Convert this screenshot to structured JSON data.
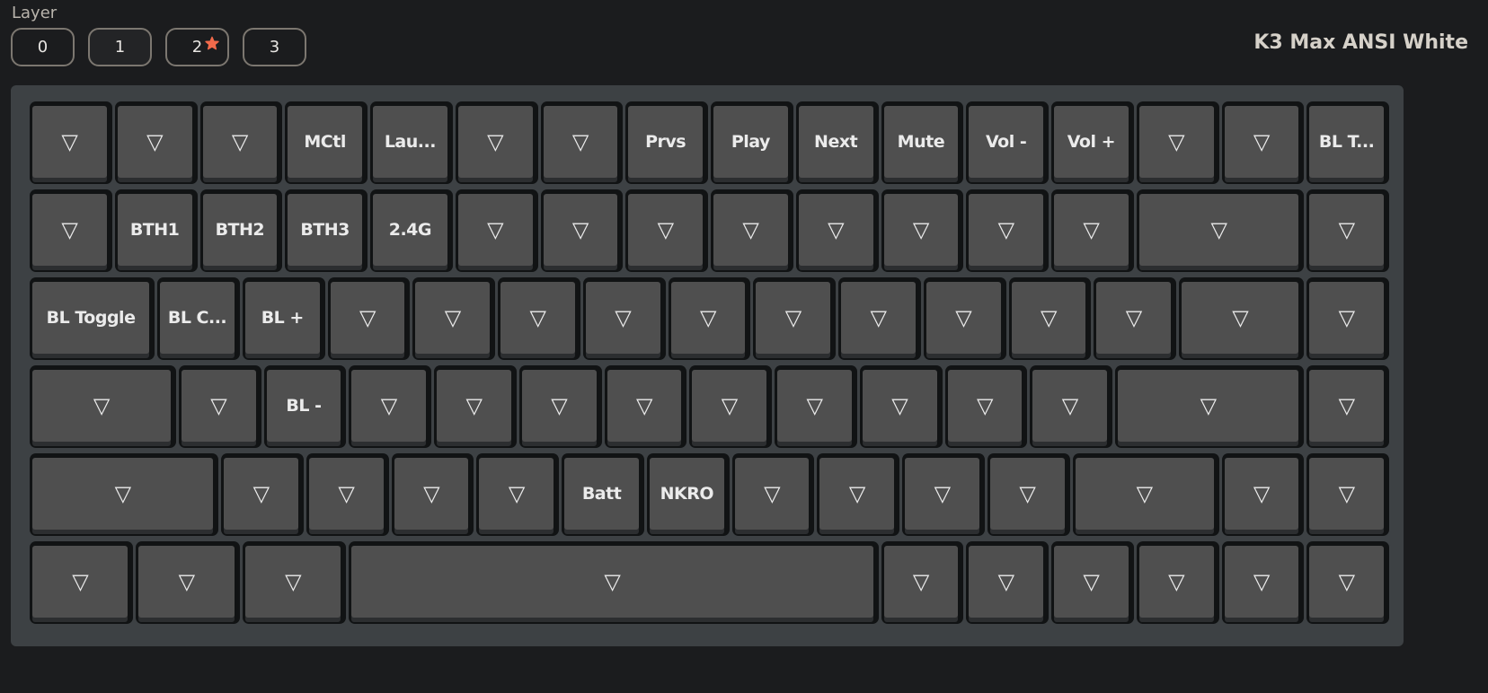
{
  "layer": {
    "label": "Layer",
    "tabs": [
      {
        "label": "0",
        "active": false,
        "starred": false
      },
      {
        "label": "1",
        "active": true,
        "starred": false
      },
      {
        "label": "2",
        "active": false,
        "starred": true
      },
      {
        "label": "3",
        "active": false,
        "starred": false
      }
    ],
    "star_color": "#f26a4b"
  },
  "keyboard_name": "K3 Max ANSI White",
  "transparent_glyph": "▽",
  "rows": [
    [
      {
        "w": 1,
        "label": "▽"
      },
      {
        "w": 1,
        "label": "▽"
      },
      {
        "w": 1,
        "label": "▽"
      },
      {
        "w": 1,
        "label": "MCtl"
      },
      {
        "w": 1,
        "label": "Lau..."
      },
      {
        "w": 1,
        "label": "▽"
      },
      {
        "w": 1,
        "label": "▽"
      },
      {
        "w": 1,
        "label": "Prvs"
      },
      {
        "w": 1,
        "label": "Play"
      },
      {
        "w": 1,
        "label": "Next"
      },
      {
        "w": 1,
        "label": "Mute"
      },
      {
        "w": 1,
        "label": "Vol -"
      },
      {
        "w": 1,
        "label": "Vol +"
      },
      {
        "w": 1,
        "label": "▽"
      },
      {
        "w": 1,
        "label": "▽"
      },
      {
        "w": 1,
        "label": "BL T..."
      }
    ],
    [
      {
        "w": 1,
        "label": "▽"
      },
      {
        "w": 1,
        "label": "BTH1"
      },
      {
        "w": 1,
        "label": "BTH2"
      },
      {
        "w": 1,
        "label": "BTH3"
      },
      {
        "w": 1,
        "label": "2.4G"
      },
      {
        "w": 1,
        "label": "▽"
      },
      {
        "w": 1,
        "label": "▽"
      },
      {
        "w": 1,
        "label": "▽"
      },
      {
        "w": 1,
        "label": "▽"
      },
      {
        "w": 1,
        "label": "▽"
      },
      {
        "w": 1,
        "label": "▽"
      },
      {
        "w": 1,
        "label": "▽"
      },
      {
        "w": 1,
        "label": "▽"
      },
      {
        "w": 2,
        "label": "▽"
      },
      {
        "w": 1,
        "label": "▽"
      }
    ],
    [
      {
        "w": 1.5,
        "label": "BL Toggle"
      },
      {
        "w": 1,
        "label": "BL C..."
      },
      {
        "w": 1,
        "label": "BL +"
      },
      {
        "w": 1,
        "label": "▽"
      },
      {
        "w": 1,
        "label": "▽"
      },
      {
        "w": 1,
        "label": "▽"
      },
      {
        "w": 1,
        "label": "▽"
      },
      {
        "w": 1,
        "label": "▽"
      },
      {
        "w": 1,
        "label": "▽"
      },
      {
        "w": 1,
        "label": "▽"
      },
      {
        "w": 1,
        "label": "▽"
      },
      {
        "w": 1,
        "label": "▽"
      },
      {
        "w": 1,
        "label": "▽"
      },
      {
        "w": 1.5,
        "label": "▽"
      },
      {
        "w": 1,
        "label": "▽"
      }
    ],
    [
      {
        "w": 1.75,
        "label": "▽"
      },
      {
        "w": 1,
        "label": "▽"
      },
      {
        "w": 1,
        "label": "BL -"
      },
      {
        "w": 1,
        "label": "▽"
      },
      {
        "w": 1,
        "label": "▽"
      },
      {
        "w": 1,
        "label": "▽"
      },
      {
        "w": 1,
        "label": "▽"
      },
      {
        "w": 1,
        "label": "▽"
      },
      {
        "w": 1,
        "label": "▽"
      },
      {
        "w": 1,
        "label": "▽"
      },
      {
        "w": 1,
        "label": "▽"
      },
      {
        "w": 1,
        "label": "▽"
      },
      {
        "w": 2.25,
        "label": "▽"
      },
      {
        "w": 1,
        "label": "▽"
      }
    ],
    [
      {
        "w": 2.25,
        "label": "▽"
      },
      {
        "w": 1,
        "label": "▽"
      },
      {
        "w": 1,
        "label": "▽"
      },
      {
        "w": 1,
        "label": "▽"
      },
      {
        "w": 1,
        "label": "▽"
      },
      {
        "w": 1,
        "label": "Batt"
      },
      {
        "w": 1,
        "label": "NKRO"
      },
      {
        "w": 1,
        "label": "▽"
      },
      {
        "w": 1,
        "label": "▽"
      },
      {
        "w": 1,
        "label": "▽"
      },
      {
        "w": 1,
        "label": "▽"
      },
      {
        "w": 1.75,
        "label": "▽"
      },
      {
        "w": 1,
        "label": "▽"
      },
      {
        "w": 1,
        "label": "▽"
      }
    ],
    [
      {
        "w": 1.25,
        "label": "▽"
      },
      {
        "w": 1.25,
        "label": "▽"
      },
      {
        "w": 1.25,
        "label": "▽"
      },
      {
        "w": 6.25,
        "label": "▽"
      },
      {
        "w": 1,
        "label": "▽"
      },
      {
        "w": 1,
        "label": "▽"
      },
      {
        "w": 1,
        "label": "▽"
      },
      {
        "w": 1,
        "label": "▽"
      },
      {
        "w": 1,
        "label": "▽"
      },
      {
        "w": 1,
        "label": "▽"
      }
    ]
  ]
}
